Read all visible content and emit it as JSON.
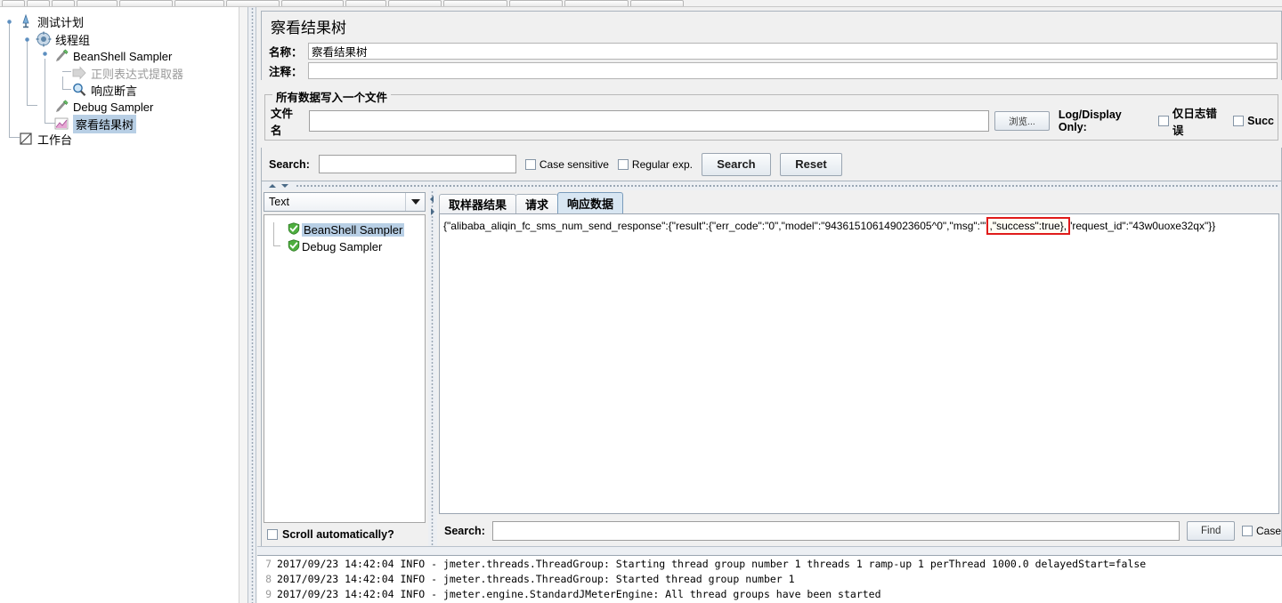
{
  "toolbar": {
    "button_count": 14
  },
  "tree": {
    "items": [
      {
        "label": "测试计划",
        "icon": "test-plan-icon",
        "depth": 0,
        "state": "normal"
      },
      {
        "label": "线程组",
        "icon": "thread-group-icon",
        "depth": 1,
        "state": "normal"
      },
      {
        "label": "BeanShell Sampler",
        "icon": "sampler-icon",
        "depth": 2,
        "state": "normal"
      },
      {
        "label": "正则表达式提取器",
        "icon": "post-processor-icon",
        "depth": 3,
        "state": "disabled"
      },
      {
        "label": "响应断言",
        "icon": "assertion-icon",
        "depth": 3,
        "state": "normal"
      },
      {
        "label": "Debug Sampler",
        "icon": "sampler-icon",
        "depth": 2,
        "state": "normal"
      },
      {
        "label": "察看结果树",
        "icon": "view-results-tree-icon",
        "depth": 2,
        "state": "selected"
      },
      {
        "label": "工作台",
        "icon": "workbench-icon",
        "depth": 0,
        "state": "normal"
      }
    ]
  },
  "panel": {
    "title": "察看结果树",
    "name_label": "名称：",
    "name_value": "察看结果树",
    "comment_label": "注释：",
    "comment_value": ""
  },
  "file_group": {
    "title": "所有数据写入一个文件",
    "filename_label": "文件名",
    "filename_value": "",
    "browse_label": "浏览...",
    "log_display_label": "Log/Display Only:",
    "checkboxes": [
      {
        "label": "仅日志错误",
        "checked": false
      },
      {
        "label": "Succ",
        "checked": false
      }
    ]
  },
  "search_bar": {
    "label": "Search:",
    "value": "",
    "case_sensitive_label": "Case sensitive",
    "case_sensitive_checked": false,
    "regular_exp_label": "Regular exp.",
    "regular_exp_checked": false,
    "search_button": "Search",
    "reset_button": "Reset"
  },
  "results": {
    "render_selector": "Text",
    "samplers": [
      {
        "name": "BeanShell Sampler",
        "status": "success",
        "selected": true
      },
      {
        "name": "Debug Sampler",
        "status": "success",
        "selected": false
      }
    ],
    "scroll_automatically_label": "Scroll automatically?",
    "scroll_automatically_checked": false,
    "tabs": [
      {
        "label": "取样器结果",
        "active": false
      },
      {
        "label": "请求",
        "active": false
      },
      {
        "label": "响应数据",
        "active": true
      }
    ],
    "response": {
      "before": "{\"alibaba_aliqin_fc_sms_num_send_response\":{\"result\":{\"err_code\":\"0\",\"model\":\"943615106149023605^0\",\"msg\":\"\"",
      "highlighted": ",\"success\":true},",
      "after": "\"request_id\":\"43w0uoxe32qx\"}}",
      "highlight_color": "#e01b1b"
    },
    "find_bar": {
      "label": "Search:",
      "value": "",
      "find_button": "Find",
      "case_label": "Case"
    }
  },
  "log": {
    "lines": [
      {
        "num": "7",
        "text": "2017/09/23 14:42:04 INFO  - jmeter.threads.ThreadGroup: Starting thread group number 1 threads 1 ramp-up 1 perThread 1000.0 delayedStart=false"
      },
      {
        "num": "8",
        "text": "2017/09/23 14:42:04 INFO  - jmeter.threads.ThreadGroup: Started thread group number 1"
      },
      {
        "num": "9",
        "text": "2017/09/23 14:42:04 INFO  - jmeter.engine.StandardJMeterEngine: All thread groups have been started"
      }
    ]
  }
}
